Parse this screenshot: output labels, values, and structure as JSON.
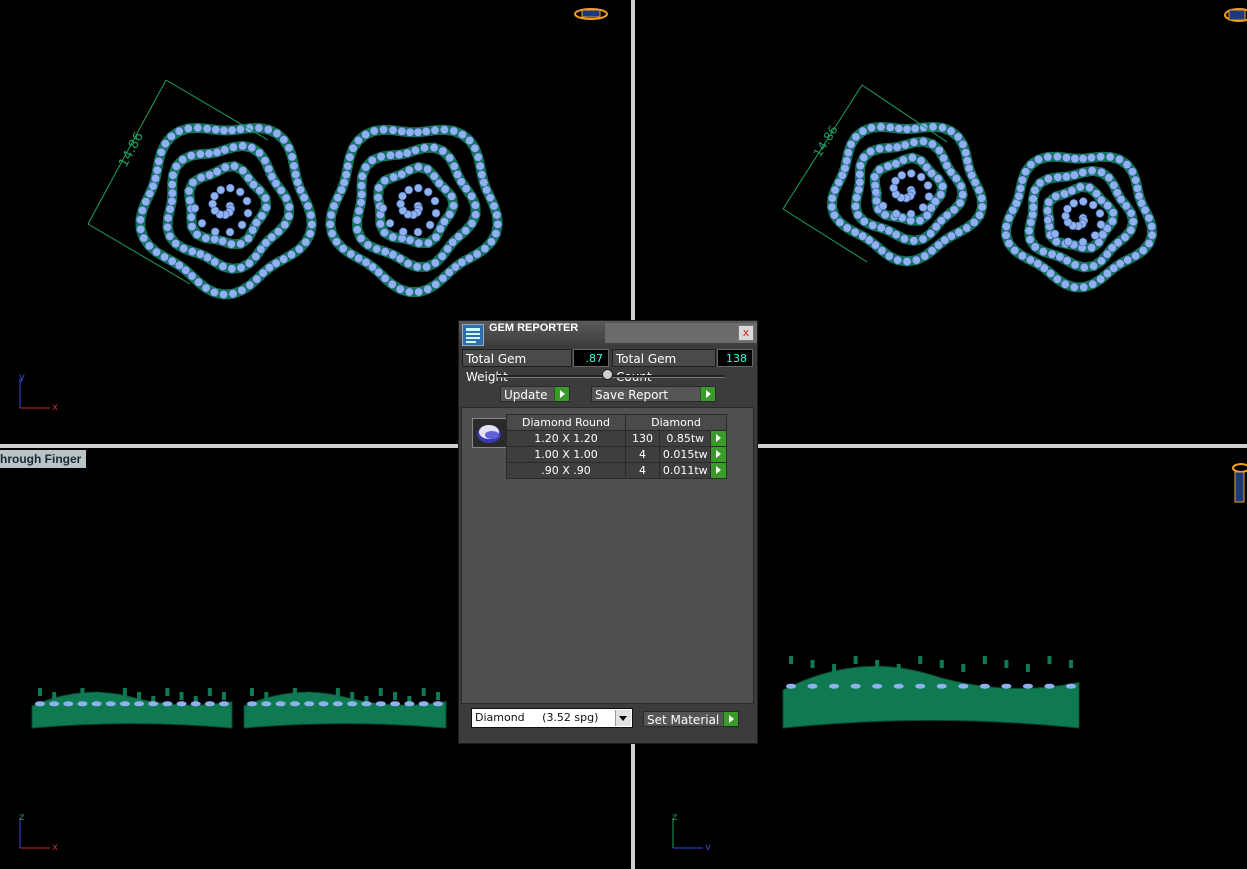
{
  "viewports": {
    "top_left": {
      "dimension": "14.86"
    },
    "top_right": {
      "dimension": "14.86"
    },
    "bottom_left": {
      "label": "hrough Finger"
    }
  },
  "axes": {
    "top_left": {
      "v": "y",
      "h": "x"
    },
    "bottom_left": {
      "v": "z",
      "h": "x"
    },
    "bottom_right": {
      "v": "z",
      "h": "y"
    }
  },
  "colors": {
    "metal": "#0f7a52",
    "gem": "#8fb2ee",
    "dimension": "#1fa060",
    "background": "#000000"
  },
  "gem_reporter": {
    "title": "GEM REPORTER",
    "close": "x",
    "total_weight_label": "Total Gem Weight",
    "total_weight_value": ".87",
    "total_count_label": "Total Gem Count",
    "total_count_value": "138",
    "update_label": "Update",
    "save_report_label": "Save Report",
    "table": {
      "header_shape": "Diamond Round",
      "header_material": "Diamond",
      "rows": [
        {
          "size": "1.20 X 1.20",
          "count": "130",
          "weight": "0.85tw"
        },
        {
          "size": "1.00 X 1.00",
          "count": "4",
          "weight": "0.015tw"
        },
        {
          "size": ".90 X .90",
          "count": "4",
          "weight": "0.011tw"
        }
      ]
    },
    "material_select": "Diamond     (3.52 spg)",
    "set_material_label": "Set Material"
  }
}
